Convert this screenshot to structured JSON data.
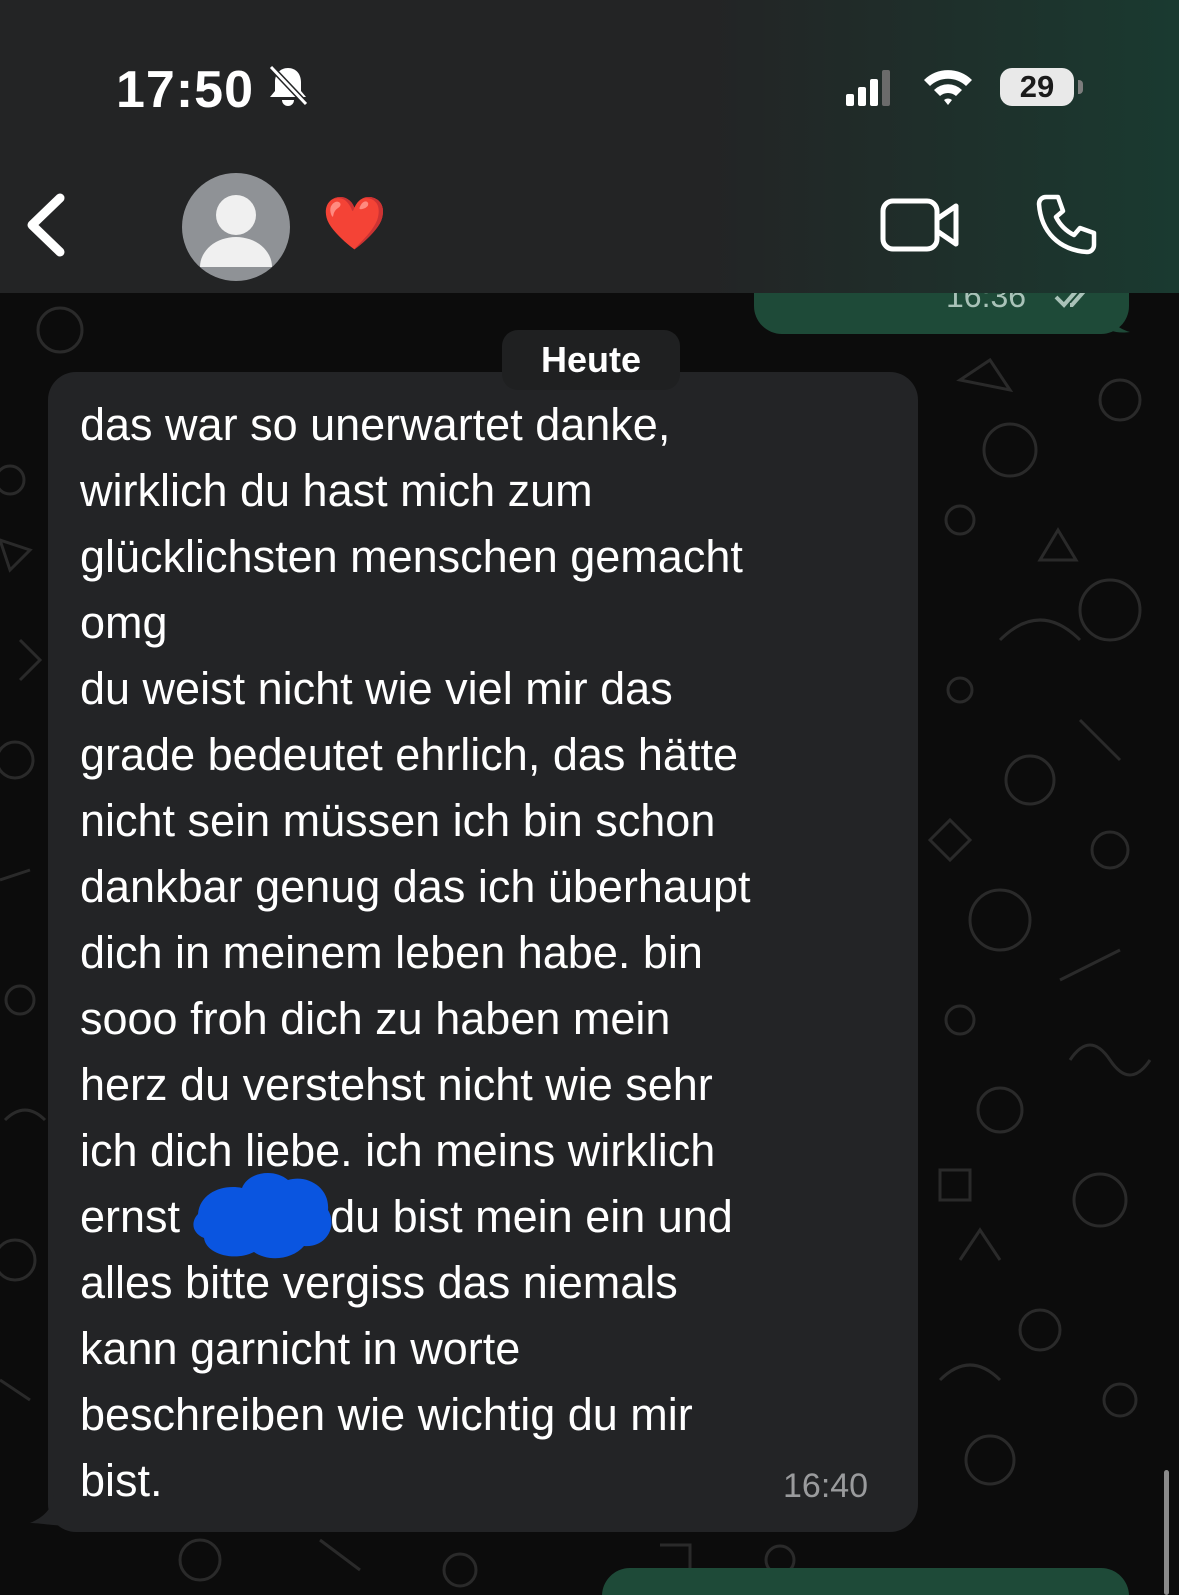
{
  "status_bar": {
    "time": "17:50",
    "battery": "29",
    "icons": [
      "bell-slash-icon",
      "signal-bars-icon",
      "wifi-icon",
      "battery-icon"
    ]
  },
  "header": {
    "back_icon": "chevron-left-icon",
    "contact_name": "❤️",
    "video_icon": "video-camera-icon",
    "phone_icon": "phone-icon"
  },
  "date_separator": "Heute",
  "messages": [
    {
      "direction": "outgoing",
      "time": "16:36",
      "status": "read"
    },
    {
      "direction": "incoming",
      "time": "16:40",
      "text": "das war so unerwartet danke,\nwirklich du hast mich zum\nglücklichsten menschen gemacht\nomg\ndu weist nicht wie viel mir das\ngrade bedeutet ehrlich, das hätte\nnicht sein müssen ich bin schon\ndankbar genug das ich überhaupt\ndich in meinem leben habe. bin\nsooo froh dich zu haben mein\nherz du verstehst nicht wie sehr\nich dich liebe. ich meins wirklich\nernst            du bist mein ein und\nalles bitte vergiss das niemals\nkann garnicht in worte\nbeschreiben wie wichtig du mir\nbist."
    }
  ],
  "colors": {
    "header_bg": "#232425",
    "incoming_bubble": "#232426",
    "outgoing_bubble": "#1e4a38",
    "redaction": "#0a55e0"
  }
}
